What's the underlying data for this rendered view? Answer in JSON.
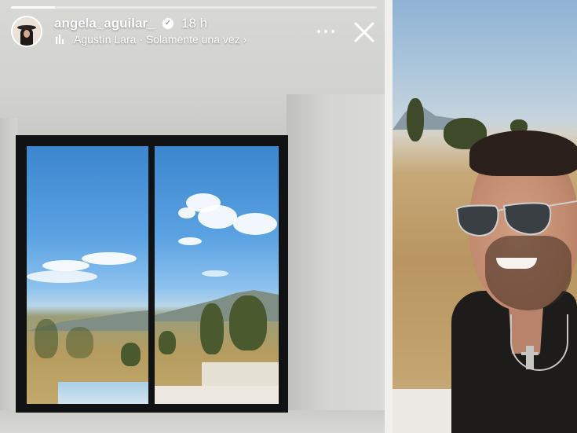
{
  "story": {
    "username": "angela_aguilar_",
    "time_ago": "18 h",
    "song": "Agustín Lara · Solamente una vez",
    "song_chevron": "›",
    "progress": 0.12
  },
  "icons": {
    "verified": "verified-badge-icon",
    "music": "music-bars-icon",
    "more": "more-options-icon",
    "close": "close-icon",
    "chevron": "chevron-right-icon"
  },
  "colors": {
    "text": "#ffffff",
    "window_frame": "#111214",
    "sky": "#4c97dc",
    "shirt": "#1d1c1b"
  }
}
